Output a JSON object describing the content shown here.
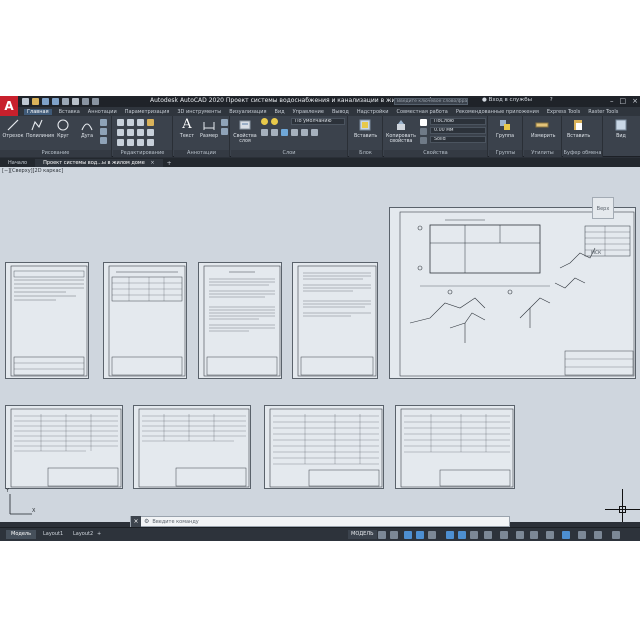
{
  "app": {
    "logo_letter": "A",
    "title": "Autodesk AutoCAD 2020   Проект системы водоснабжения и канализации в жилом доме.dwg",
    "search_placeholder": "Введите ключевое слово/фразу",
    "user": "Вход в службы",
    "help": "?"
  },
  "ribbon_tabs": [
    "Главная",
    "Вставка",
    "Аннотации",
    "Параметризация",
    "3D инструменты",
    "Визуализация",
    "Вид",
    "Управление",
    "Вывод",
    "Надстройки",
    "Совместная работа",
    "Рекомендованные приложения",
    "Express Tools",
    "Raster Tools"
  ],
  "ribbon_groups": {
    "draw": {
      "label": "Рисование",
      "buttons": [
        "Отрезок",
        "Полилиния",
        "Круг",
        "Дуга"
      ]
    },
    "modify": {
      "label": "Редактирование"
    },
    "annotation": {
      "label": "Аннотации",
      "buttons": [
        "Текст",
        "Размер"
      ]
    },
    "layers": {
      "label": "Слои",
      "buttons": [
        "Свойства слоя"
      ],
      "current_layer": "По умолчанию"
    },
    "block": {
      "label": "Блок",
      "buttons": [
        "Вставить"
      ]
    },
    "properties": {
      "label": "Свойства",
      "buttons": [
        "Копировать свойства"
      ],
      "color": "ПоСлою",
      "lineweight": "0.00 мм",
      "linetype": "Solid"
    },
    "groups": {
      "label": "Группы",
      "buttons": [
        "Группа"
      ]
    },
    "utilities": {
      "label": "Утилиты",
      "buttons": [
        "Измерить"
      ]
    },
    "clipboard": {
      "label": "Буфер обмена",
      "buttons": [
        "Вставить"
      ]
    },
    "view": {
      "label": "",
      "buttons": [
        "Вид"
      ]
    }
  },
  "file_tabs": {
    "start": "Начало",
    "active": "Проект системы вод...ы в жилом доме",
    "close": "×",
    "add": "+"
  },
  "canvas": {
    "viewport_label": "[−][Сверху][2D каркас]",
    "viewcube_face": "Верх",
    "wcs_label": "МСК",
    "ucs_x": "X",
    "ucs_y": "Y"
  },
  "command_line": {
    "close": "×",
    "prompt": "Введите команду"
  },
  "status_bar": {
    "layout_tabs": [
      "Модель",
      "Layout1",
      "Layout2"
    ],
    "add": "+",
    "model_button": "МОДЕЛЬ"
  },
  "colors": {
    "accent": "#3f5a78",
    "logo": "#c8202c",
    "canvas": "#cfd6de"
  }
}
